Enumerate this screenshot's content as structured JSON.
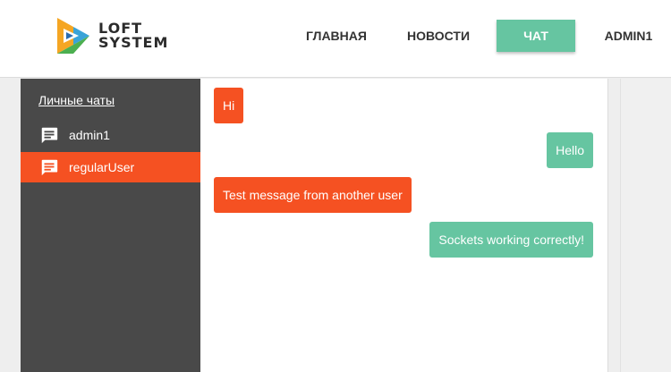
{
  "brand": {
    "line1": "LOFT",
    "line2": "SYSTEM",
    "logo_icon": "play-triangle-logo"
  },
  "nav": {
    "home": "ГЛАВНАЯ",
    "news": "НОВОСТИ",
    "chat": "ЧАТ",
    "user": "ADMIN1",
    "active": "chat",
    "active_color": "#66c5a1"
  },
  "sidebar": {
    "title": "Личные чаты",
    "items": [
      {
        "label": "admin1",
        "icon": "chat-bubble-icon",
        "active": false
      },
      {
        "label": "regularUser",
        "icon": "chat-bubble-icon",
        "active": true
      }
    ],
    "background": "#494949",
    "active_color": "#f55122"
  },
  "messages": [
    {
      "text": "Hi",
      "direction": "incoming"
    },
    {
      "text": "Hello",
      "direction": "outgoing"
    },
    {
      "text": "Test message from another user",
      "direction": "incoming"
    },
    {
      "text": "Sockets working correctly!",
      "direction": "outgoing"
    }
  ],
  "colors": {
    "incoming": "#f55122",
    "outgoing": "#66c5a1"
  }
}
